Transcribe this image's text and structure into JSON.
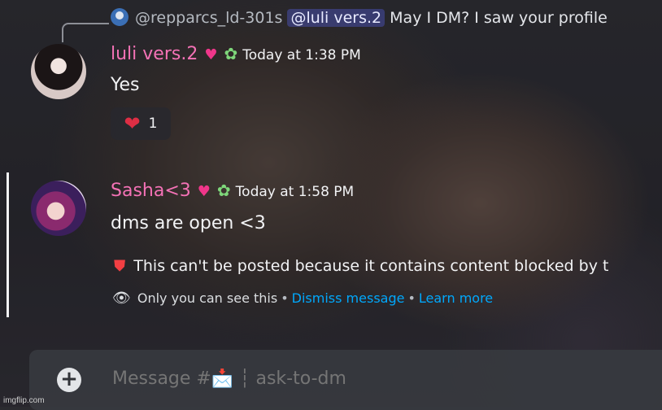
{
  "reply": {
    "username": "@repparcs_ld-301s",
    "mention": "@luli vers.2",
    "text": "May I DM? I saw your profile"
  },
  "messages": [
    {
      "username": "luli vers.2",
      "timestamp": "Today at 1:38 PM",
      "text": "Yes",
      "reaction": {
        "emoji": "heart",
        "count": "1"
      }
    },
    {
      "username": "Sasha<3",
      "timestamp": "Today at 1:58 PM",
      "text": "dms are open <3",
      "system_notice": "This can't be posted because it contains content blocked by t",
      "ephemeral": {
        "label": "Only you can see this",
        "dismiss": "Dismiss message",
        "learn_more": "Learn more"
      }
    }
  ],
  "composer": {
    "placeholder": "Message #📩 ┆ ask-to-dm"
  },
  "watermark": "imgflip.com",
  "colors": {
    "username": "#f472b6",
    "link": "#00a8fc",
    "blocked_icon": "#f23f43",
    "mention_bg": "#5865f2"
  }
}
